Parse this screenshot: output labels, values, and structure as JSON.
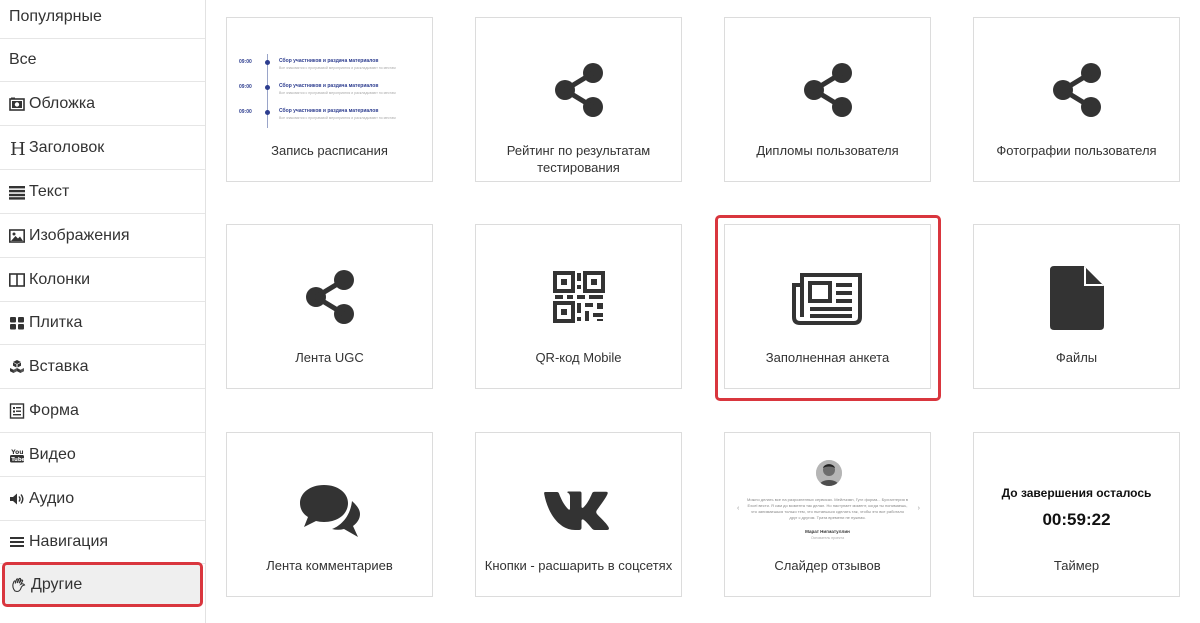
{
  "sidebar": {
    "items": [
      {
        "label": "Популярные",
        "icon": "none"
      },
      {
        "label": "Все",
        "icon": "none"
      },
      {
        "label": "Обложка",
        "icon": "camera-icon"
      },
      {
        "label": "Заголовок",
        "icon": "heading-icon"
      },
      {
        "label": "Текст",
        "icon": "text-lines-icon"
      },
      {
        "label": "Изображения",
        "icon": "image-icon"
      },
      {
        "label": "Колонки",
        "icon": "columns-icon"
      },
      {
        "label": "Плитка",
        "icon": "tiles-icon"
      },
      {
        "label": "Вставка",
        "icon": "cubes-icon"
      },
      {
        "label": "Форма",
        "icon": "form-icon"
      },
      {
        "label": "Видео",
        "icon": "youtube-icon"
      },
      {
        "label": "Аудио",
        "icon": "speaker-icon"
      },
      {
        "label": "Навигация",
        "icon": "menu-icon"
      },
      {
        "label": "Другие",
        "icon": "hand-icon",
        "active": true
      }
    ]
  },
  "tiles": [
    {
      "label": "Запись расписания",
      "preview": "schedule"
    },
    {
      "label": "Рейтинг по результатам тестирования",
      "icon": "share-icon"
    },
    {
      "label": "Дипломы пользователя",
      "icon": "share-icon"
    },
    {
      "label": "Фотографии пользователя",
      "icon": "share-icon"
    },
    {
      "label": "Лента UGC",
      "icon": "share-icon"
    },
    {
      "label": "QR-код Mobile",
      "icon": "qr-code-icon"
    },
    {
      "label": "Заполненная анкета",
      "icon": "newspaper-icon",
      "highlighted": true
    },
    {
      "label": "Файлы",
      "icon": "file-icon"
    },
    {
      "label": "Лента комментариев",
      "icon": "comments-icon"
    },
    {
      "label": "Кнопки - расшарить в соцсетях",
      "icon": "vk-icon"
    },
    {
      "label": "Слайдер отзывов",
      "preview": "reviews"
    },
    {
      "label": "Таймер",
      "preview": "timer"
    }
  ],
  "schedule_preview": {
    "rows": [
      {
        "time": "09:00",
        "title": "Сбор участников и раздача материалов",
        "desc": "Все знакомятся с программой мероприятия и раскладывают по местам"
      },
      {
        "time": "09:00",
        "title": "Сбор участников и раздача материалов",
        "desc": "Все знакомятся с программой мероприятия и раскладывают по местам"
      },
      {
        "time": "09:00",
        "title": "Сбор участников и раздача материалов",
        "desc": "Все знакомятся с программой мероприятия и раскладывают по местам"
      }
    ]
  },
  "reviews_preview": {
    "text": "Можно делать все на разрозненных сервисах. Мейлчимп, Гугл форма... Бухгалтерия в Excel вести. Я сам до момента так делал. Но наступает момент, когда ты понимаешь, что занимаешься только тем, что пытаешься сделать так, чтобы это все работало друг с другом. Трата времени не нужная.",
    "name": "Марат Нигматуллин",
    "role": "Основатель проекта"
  },
  "timer_preview": {
    "title": "До завершения осталось",
    "value": "00:59:22"
  },
  "colors": {
    "accent_red": "#d9363e",
    "icon_dark": "#333333",
    "schedule_blue": "#2d3d8f"
  }
}
